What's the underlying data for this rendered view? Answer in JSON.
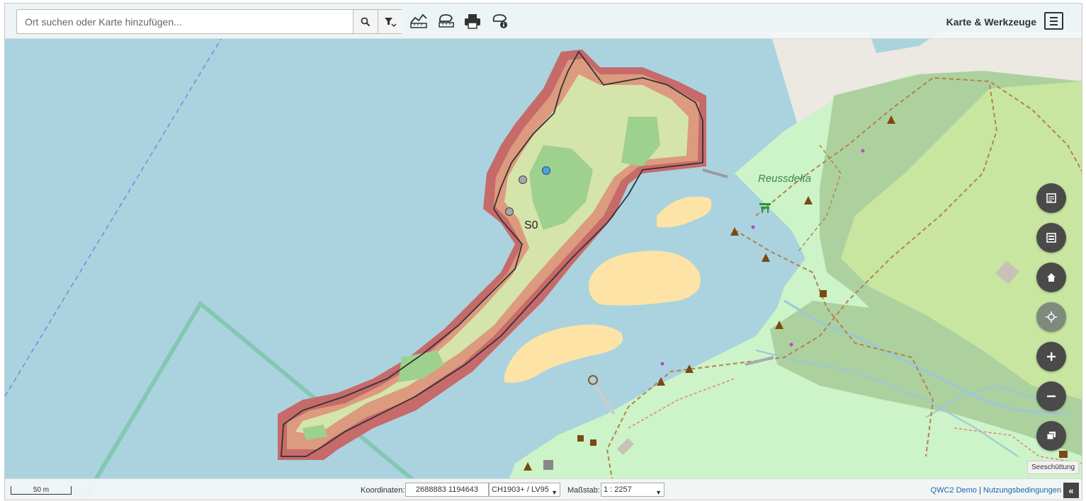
{
  "search": {
    "placeholder": "Ort suchen oder Karte hinzufügen..."
  },
  "toolbar": {
    "icons": [
      "search-icon",
      "filter-icon",
      "height-profile-icon",
      "measure-icon",
      "print-icon",
      "identify-icon"
    ]
  },
  "menu": {
    "title": "Karte & Werkzeuge"
  },
  "map": {
    "labels": {
      "area_name": "Reussdelta",
      "point_label": "S0"
    }
  },
  "side_buttons": [
    "layer-tree-icon",
    "legend-icon",
    "home-icon",
    "locate-icon",
    "zoom-in-icon",
    "zoom-out-icon",
    "background-switcher-icon"
  ],
  "tooltip": "Seeschüttung",
  "bottombar": {
    "scale_bar_label": "50 m",
    "coordinates_label": "Koordinaten:",
    "coordinates_value": "2688883 1194643",
    "crs": "CH1903+ / LV95",
    "scale_label": "Maßstab:",
    "scale_value": "1 : 2257",
    "link_demo": "QWC2 Demo",
    "link_separator": "|",
    "link_terms": "Nutzungsbedingungen",
    "collapse_glyph": "«"
  },
  "colors": {
    "water": "#aad3df",
    "land_light": "#cdf3c8",
    "land_forest": "#add19e",
    "sand": "#fde4a6",
    "raster_high": "#c76a6a",
    "raster_mid": "#e0a080",
    "raster_low": "#d4e2a8",
    "raster_green": "#8ec98a",
    "ui_dark": "#4a4a4a"
  }
}
